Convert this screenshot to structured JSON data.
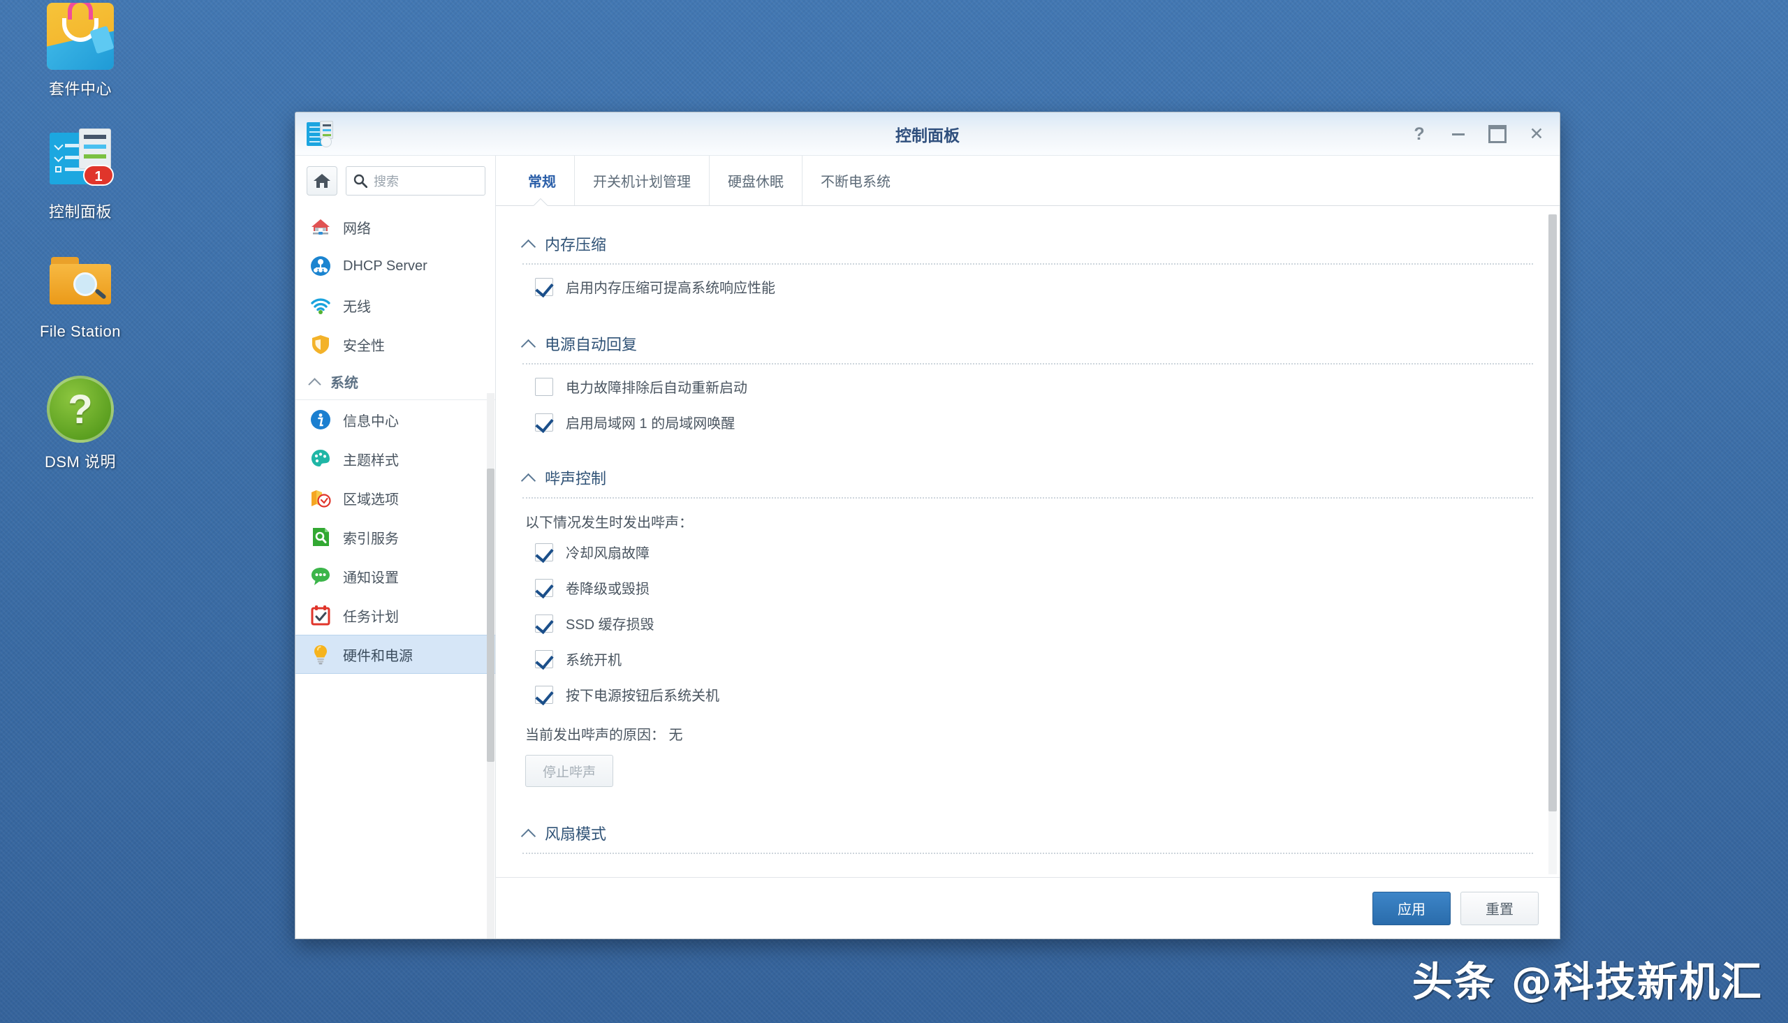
{
  "desktop": {
    "icons": [
      {
        "label": "套件中心",
        "icon": "package-center-icon"
      },
      {
        "label": "控制面板",
        "icon": "control-panel-icon",
        "badge": "1"
      },
      {
        "label": "File Station",
        "icon": "file-station-icon"
      },
      {
        "label": "DSM 说明",
        "icon": "dsm-help-icon",
        "glyph": "?"
      }
    ],
    "watermark": "头条 @科技新机汇",
    "background_color": "#3e72ad"
  },
  "window": {
    "title": "控制面板",
    "icon": "control-panel-icon",
    "controls": [
      {
        "name": "help",
        "glyph": "?"
      },
      {
        "name": "minimize",
        "glyph": "—"
      },
      {
        "name": "maximize",
        "glyph": "▢"
      },
      {
        "name": "close",
        "glyph": "✕"
      }
    ]
  },
  "sidebar": {
    "home_button": "home-icon",
    "search": {
      "placeholder": "搜索",
      "value": ""
    },
    "items": [
      {
        "label": "网络",
        "icon": "network-home-icon",
        "type": "item",
        "selected": false
      },
      {
        "label": "DHCP Server",
        "icon": "dhcp-server-icon",
        "type": "item",
        "selected": false
      },
      {
        "label": "无线",
        "icon": "wireless-icon",
        "type": "item",
        "selected": false
      },
      {
        "label": "安全性",
        "icon": "shield-icon",
        "type": "item",
        "selected": false
      },
      {
        "label": "系统",
        "icon": "chevron-up-icon",
        "type": "group",
        "selected": false
      },
      {
        "label": "信息中心",
        "icon": "info-icon",
        "type": "item",
        "selected": false
      },
      {
        "label": "主题样式",
        "icon": "palette-icon",
        "type": "item",
        "selected": false
      },
      {
        "label": "区域选项",
        "icon": "regional-options-icon",
        "type": "item",
        "selected": false
      },
      {
        "label": "索引服务",
        "icon": "indexing-service-icon",
        "type": "item",
        "selected": false
      },
      {
        "label": "通知设置",
        "icon": "notification-icon",
        "type": "item",
        "selected": false
      },
      {
        "label": "任务计划",
        "icon": "task-scheduler-icon",
        "type": "item",
        "selected": false
      },
      {
        "label": "硬件和电源",
        "icon": "lightbulb-icon",
        "type": "item",
        "selected": true
      }
    ]
  },
  "main": {
    "tabs": [
      {
        "label": "常规",
        "active": true
      },
      {
        "label": "开关机计划管理",
        "active": false
      },
      {
        "label": "硬盘休眠",
        "active": false
      },
      {
        "label": "不断电系统",
        "active": false
      }
    ],
    "sections": [
      {
        "title": "内存压缩",
        "collapse_icon": "chevron-up-icon",
        "checkboxes": [
          {
            "label": "启用内存压缩可提高系统响应性能",
            "checked": true
          }
        ]
      },
      {
        "title": "电源自动回复",
        "collapse_icon": "chevron-up-icon",
        "checkboxes": [
          {
            "label": "电力故障排除后自动重新启动",
            "checked": false
          },
          {
            "label": "启用局域网 1 的局域网唤醒",
            "checked": true
          }
        ]
      },
      {
        "title": "哔声控制",
        "collapse_icon": "chevron-up-icon",
        "intro": "以下情况发生时发出哔声：",
        "checkboxes": [
          {
            "label": "冷却风扇故障",
            "checked": true
          },
          {
            "label": "卷降级或毁损",
            "checked": true
          },
          {
            "label": "SSD 缓存损毁",
            "checked": true
          },
          {
            "label": "系统开机",
            "checked": true
          },
          {
            "label": "按下电源按钮后系统关机",
            "checked": true
          }
        ],
        "status": "当前发出哔声的原因：  无",
        "button": {
          "label": "停止哔声",
          "disabled": true
        }
      },
      {
        "title": "风扇模式",
        "collapse_icon": "chevron-up-icon",
        "checkboxes": []
      }
    ],
    "footer": {
      "apply_label": "应用",
      "reset_label": "重置"
    }
  },
  "colors": {
    "accent": "#2a6cab",
    "selected_nav": "#d6e6f7",
    "section_title": "#2f5276",
    "badge": "#e0352b"
  }
}
